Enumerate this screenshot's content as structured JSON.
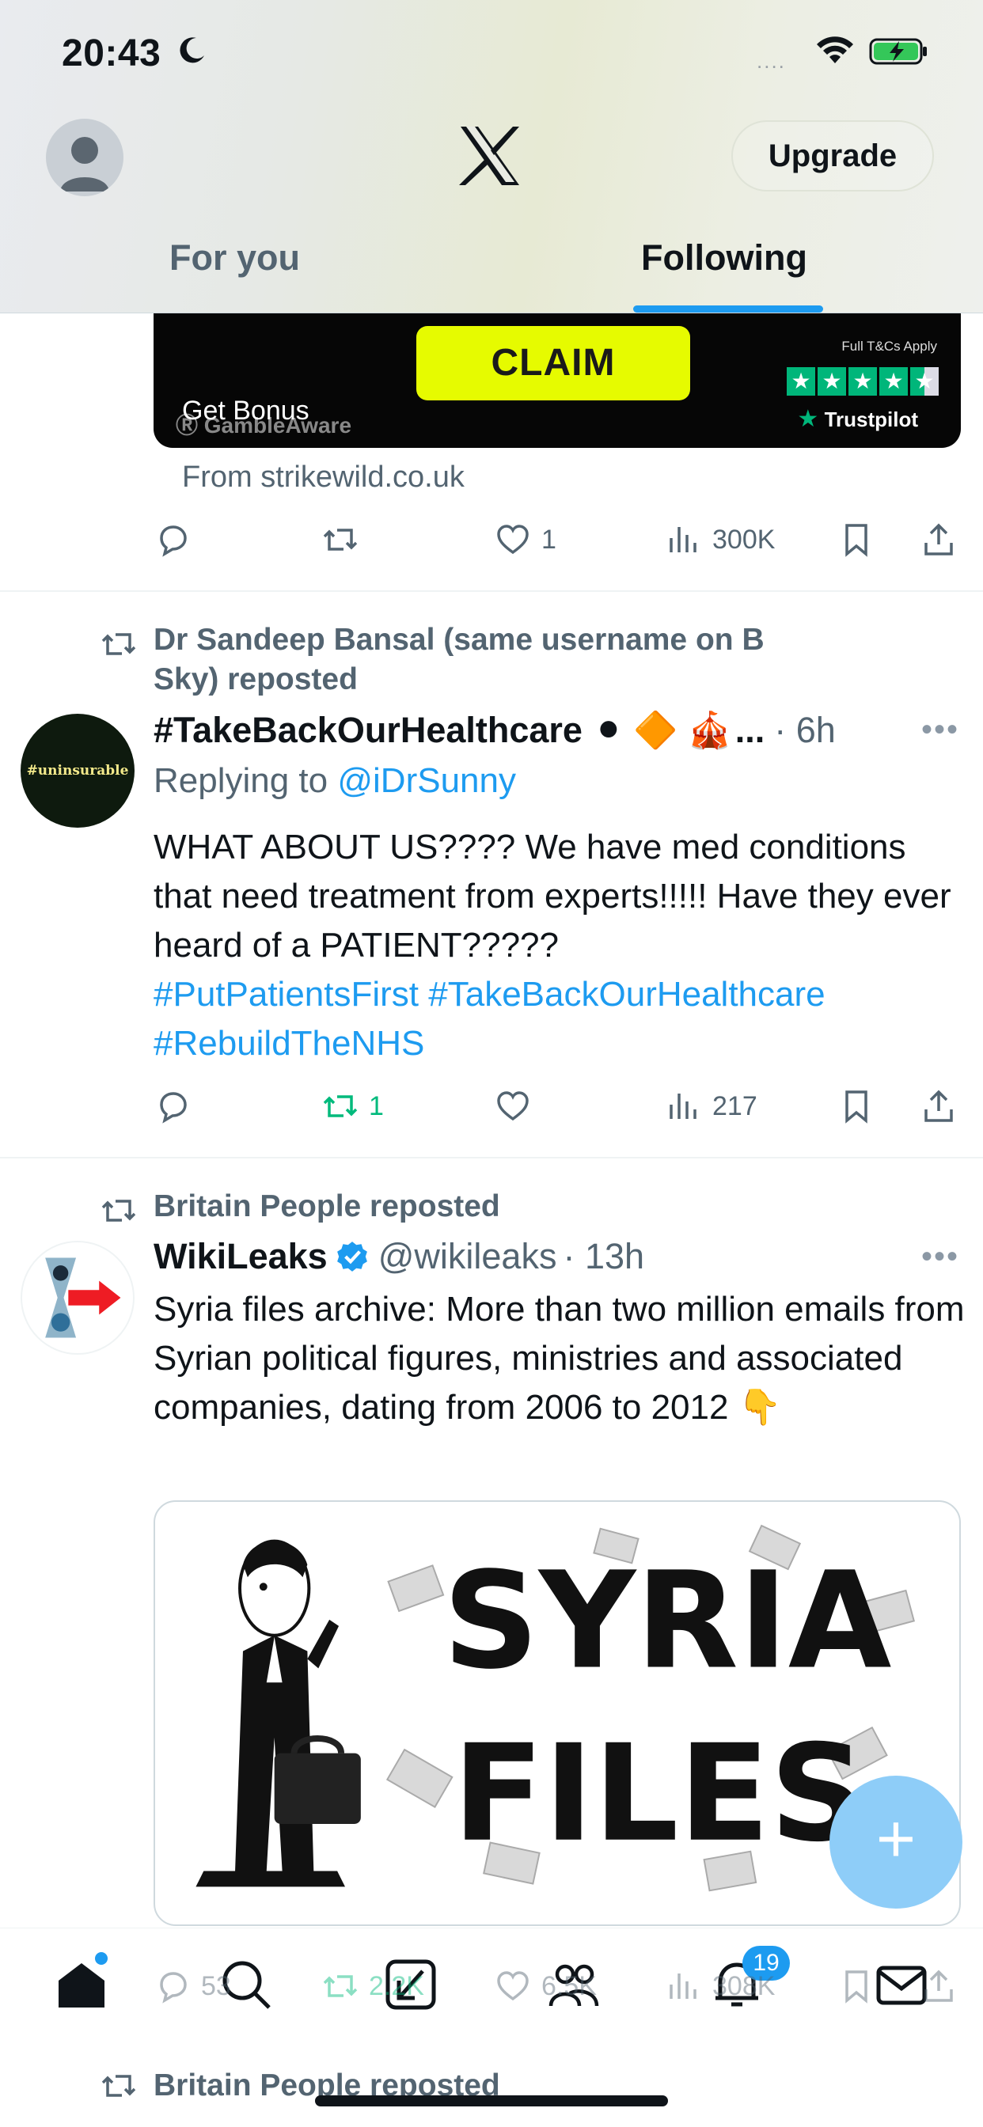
{
  "status_bar": {
    "time": "20:43",
    "signal": "....",
    "moon": "moon-icon",
    "wifi": "wifi-icon",
    "battery": "battery-charging-icon"
  },
  "header": {
    "upgrade_label": "Upgrade",
    "tabs": [
      {
        "label": "For you",
        "active": false
      },
      {
        "label": "Following",
        "active": true
      }
    ],
    "accent": "#1d9bf0"
  },
  "ad": {
    "claim_label": "CLAIM",
    "get_bonus": "Get Bonus",
    "gamble_aware": "GambleAware",
    "tcs": "Full T&Cs Apply",
    "trustpilot": "Trustpilot",
    "from": "From strikewild.co.uk",
    "actions": {
      "reply": "",
      "repost": "",
      "like": "1",
      "views": "300K"
    }
  },
  "post1": {
    "reposted_by": "Dr Sandeep Bansal (same username on B Sky) reposted",
    "name": "#TakeBackOurHealthcare",
    "emoji_suffix": "⚫ 🔶 🎪",
    "ellipsis": "...",
    "time": "· 6h",
    "avatar_text": "#uninsurable",
    "replying_prefix": "Replying to ",
    "replying_handle": "@iDrSunny",
    "text": "WHAT ABOUT US???? We have med conditions that need treatment from experts!!!!! Have they ever heard of a PATIENT?????",
    "hashtags_line1_a": "#PutPatientsFirst",
    "hashtags_line1_b": "#TakeBackOurHealthcare",
    "hashtags_line2": "#RebuildTheNHS",
    "actions": {
      "reply": "",
      "repost": "1",
      "like": "",
      "views": "217"
    }
  },
  "post2": {
    "reposted_by": "Britain People reposted",
    "name": "WikiLeaks",
    "handle": "@wikileaks",
    "time": "· 13h",
    "text": "Syria files archive: More than two million emails from Syrian political figures, ministries and associated companies, dating from 2006 to 2012 👇",
    "image_title_1": "SYRIA",
    "image_title_2": "FILES",
    "actions": {
      "reply": "53",
      "repost": "2.2K",
      "like": "6.5K",
      "views": "308K"
    }
  },
  "next_post": {
    "reposted_by": "Britain People reposted"
  },
  "nav": {
    "items": [
      "home-icon",
      "search-icon",
      "grok-icon",
      "communities-icon",
      "notifications-icon",
      "messages-icon"
    ],
    "notification_count": "19"
  },
  "fab_label": "+"
}
